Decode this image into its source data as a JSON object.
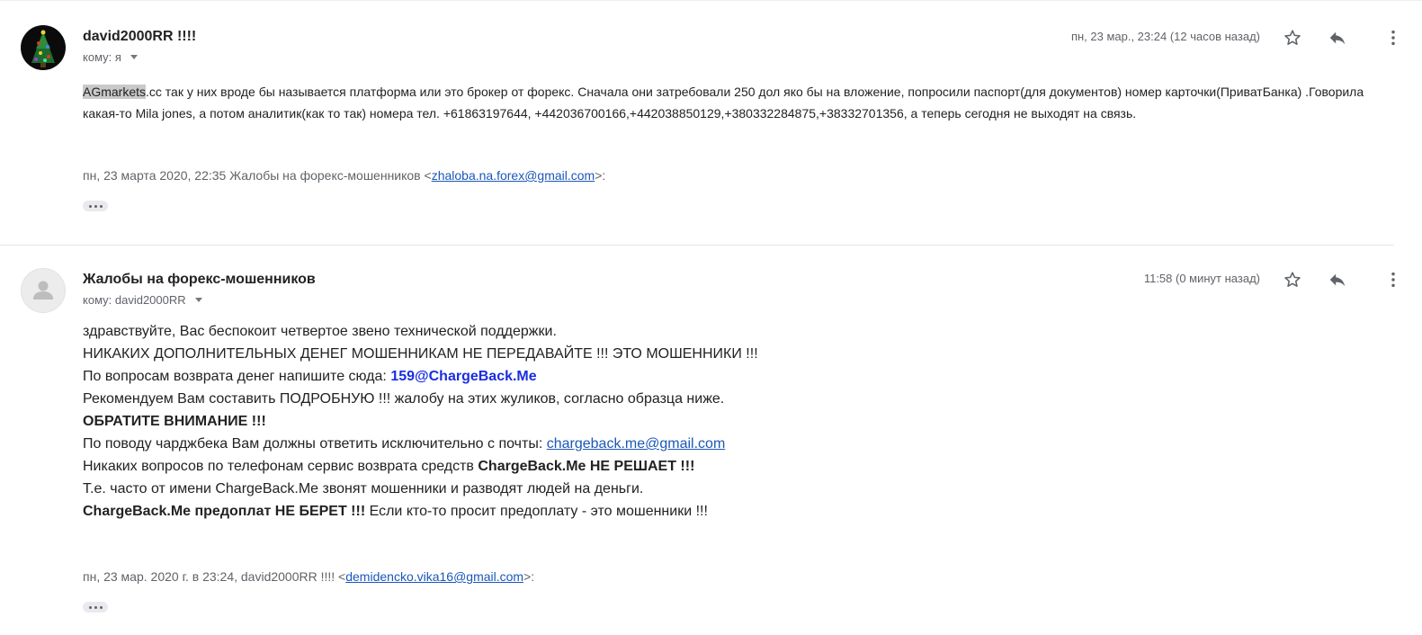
{
  "message1": {
    "sender": "david2000RR !!!!",
    "to_label": "кому: я",
    "timestamp": "пн, 23 мар., 23:24 (12 часов назад)",
    "body": {
      "highlight": "AGmarkets",
      "text": ".cc так у них вроде бы называется платформа или это брокер от форекс. Сначала они затребовали 250 дол яко бы на вложение, попросили паспорт(для документов) номер карточки(ПриватБанка) .Говорила какая-то Mila jones, а потом аналитик(как то так) номера тел. +61863197644, +442036700166,+442038850129,+380332284875,+38332701356, а теперь сегодня не выходят на связь."
    },
    "quote": {
      "prefix": "пн, 23 марта 2020, 22:35 Жалобы на форекс-мошенников <",
      "email": "zhaloba.na.forex@gmail.com",
      "suffix": ">:"
    }
  },
  "message2": {
    "sender": "Жалобы на форекс-мошенников",
    "to_label": "кому: david2000RR",
    "timestamp": "11:58 (0 минут назад)",
    "lines": {
      "l1": "здравствуйте, Вас беспокоит четвертое звено технической поддержки.",
      "l2": "НИКАКИХ ДОПОЛНИТЕЛЬНЫХ ДЕНЕГ МОШЕННИКАМ НЕ ПЕРЕДАВАЙТЕ !!! ЭТО МОШЕННИКИ !!!",
      "l3_prefix": "По вопросам возврата денег напишите сюда: ",
      "l3_contact": "159@ChargeBack.Me",
      "l4": "Рекомендуем Вам составить ПОДРОБНУЮ !!! жалобу на этих жуликов, согласно образца ниже.",
      "l5": "ОБРАТИТЕ ВНИМАНИЕ !!!",
      "l6_prefix": "По поводу чарджбека Вам должны ответить исключительно с почты: ",
      "l6_email": "chargeback.me@gmail.com",
      "l7_prefix": "Никаких вопросов по телефонам сервис возврата средств ",
      "l7_bold": "ChargeBack.Me НЕ РЕШАЕТ !!!",
      "l8": "Т.е. часто от имени ChargeBack.Me звонят мошенники и разводят людей на деньги.",
      "l9_bold": "ChargeBack.Me предоплат НЕ БЕРЕТ !!!",
      "l9_suffix": " Если кто-то просит предоплату - это мошенники !!!"
    },
    "quote": {
      "prefix": "пн, 23 мар. 2020 г. в 23:24, david2000RR !!!! <",
      "email": "demidencko.vika16@gmail.com",
      "suffix": ">:"
    }
  },
  "icons": {
    "star": "star-outline-icon",
    "reply": "reply-icon",
    "more": "more-vertical-icon",
    "caret": "chevron-down-icon",
    "ellipsis": "show-trimmed-content-icon"
  },
  "colors": {
    "link": "#1a57b8",
    "contact": "#1a2ee0",
    "highlight": "#c9c9c9",
    "meta_text": "#5f6368"
  }
}
